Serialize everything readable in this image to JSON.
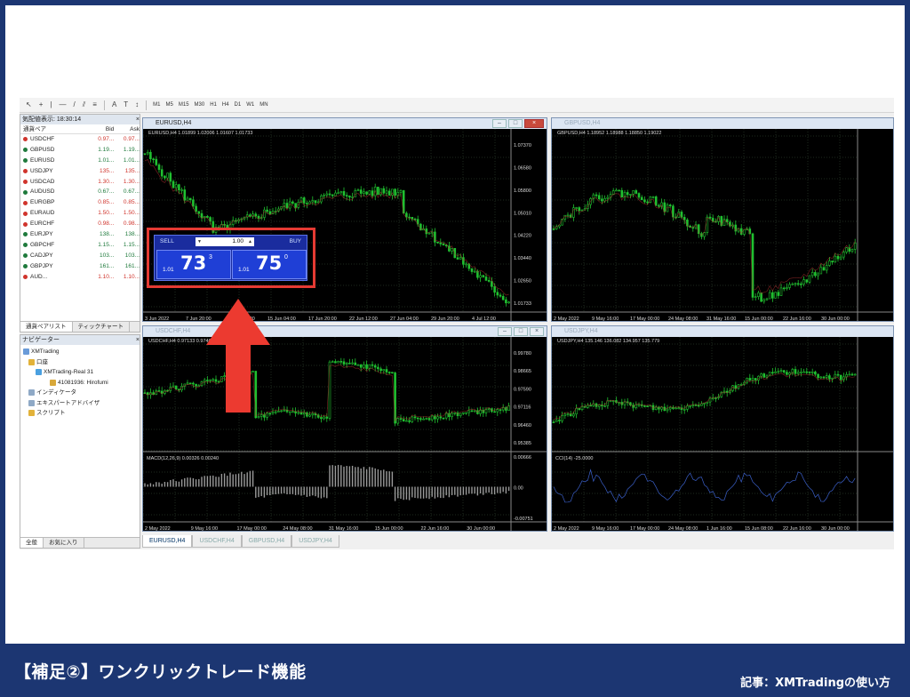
{
  "caption": "【補足②】ワンクリックトレード機能",
  "source": "記事：XMTradingの使い方",
  "toolbar": {
    "timeframes": [
      "M1",
      "M5",
      "M15",
      "M30",
      "H1",
      "H4",
      "D1",
      "W1",
      "MN"
    ]
  },
  "market_watch": {
    "title": "気配値表示: 18:30:14",
    "columns": [
      "通貨ペア",
      "Bid",
      "Ask"
    ],
    "rows": [
      {
        "symbol": "USDCHF",
        "bid": "0.97...",
        "ask": "0.97...",
        "color": "#d0342c"
      },
      {
        "symbol": "GBPUSD",
        "bid": "1.19...",
        "ask": "1.19...",
        "color": "#1f7a3c"
      },
      {
        "symbol": "EURUSD",
        "bid": "1.01...",
        "ask": "1.01...",
        "color": "#1f7a3c"
      },
      {
        "symbol": "USDJPY",
        "bid": "135...",
        "ask": "135...",
        "color": "#d0342c"
      },
      {
        "symbol": "USDCAD",
        "bid": "1.30...",
        "ask": "1.30...",
        "color": "#d0342c"
      },
      {
        "symbol": "AUDUSD",
        "bid": "0.67...",
        "ask": "0.67...",
        "color": "#1f7a3c"
      },
      {
        "symbol": "EURGBP",
        "bid": "0.85...",
        "ask": "0.85...",
        "color": "#d0342c"
      },
      {
        "symbol": "EURAUD",
        "bid": "1.50...",
        "ask": "1.50...",
        "color": "#d0342c"
      },
      {
        "symbol": "EURCHF",
        "bid": "0.98...",
        "ask": "0.98...",
        "color": "#d0342c"
      },
      {
        "symbol": "EURJPY",
        "bid": "138...",
        "ask": "138...",
        "color": "#1f7a3c"
      },
      {
        "symbol": "GBPCHF",
        "bid": "1.15...",
        "ask": "1.15...",
        "color": "#1f7a3c"
      },
      {
        "symbol": "CADJPY",
        "bid": "103...",
        "ask": "103...",
        "color": "#1f7a3c"
      },
      {
        "symbol": "GBPJPY",
        "bid": "161...",
        "ask": "161...",
        "color": "#1f7a3c"
      },
      {
        "symbol": "AUD...",
        "bid": "1.10...",
        "ask": "1.10...",
        "color": "#d0342c"
      }
    ],
    "tabs": [
      "通貨ペアリスト",
      "ティックチャート"
    ]
  },
  "navigator": {
    "title": "ナビゲーター",
    "items": [
      {
        "label": "XMTrading",
        "icon": "folder-icon"
      },
      {
        "label": "口座",
        "icon": "account-icon"
      },
      {
        "label": "XMTrading-Real 31",
        "icon": "server-icon"
      },
      {
        "label": "41081936: Hirofumi",
        "icon": "user-icon"
      },
      {
        "label": "インディケータ",
        "icon": "indicator-icon"
      },
      {
        "label": "エキスパートアドバイザ",
        "icon": "expert-icon"
      },
      {
        "label": "スクリプト",
        "icon": "script-icon"
      }
    ],
    "tabs": [
      "全般",
      "お気に入り"
    ]
  },
  "charts": [
    {
      "title": "EURUSD,H4",
      "info": "EURUSD,H4  1.01899 1.02006 1.01607 1.01733",
      "prices": [
        "1.07370",
        "1.06580",
        "1.05800",
        "1.05010",
        "1.04220",
        "1.03440",
        "1.02650",
        "1.01733"
      ],
      "dates": [
        "3 Jun 2022",
        "7 Jun 20:00",
        "10 Jun 12:00",
        "15 Jun 04:00",
        "17 Jun 20:00",
        "22 Jun 12:00",
        "27 Jun 04:00",
        "29 Jun 20:00",
        "4 Jul 12:00"
      ]
    },
    {
      "title": "GBPUSD,H4",
      "info": "GBPUSD,H4  1.18952 1.18988 1.18850 1.19022",
      "dates": [
        "2 May 2022",
        "9 May 16:00",
        "17 May 00:00",
        "24 May 08:00",
        "31 May 16:00",
        "15 Jun 00:00",
        "22 Jun 16:00",
        "30 Jun 00:00"
      ]
    },
    {
      "title": "USDCHF,H4",
      "info": "USDCHF,H4  0.97133 0.97400 0.96872 0.97116",
      "prices": [
        "0.99780",
        "0.98665",
        "0.97590",
        "0.97116",
        "0.96460",
        "0.95385"
      ],
      "indicator": "MACD(12,26,9) 0.00326 0.00240",
      "ind_prices": [
        "0.00666",
        "0.00",
        "-0.00751"
      ],
      "dates": [
        "2 May 2022",
        "9 May 16:00",
        "17 May 00:00",
        "24 May 08:00",
        "31 May 16:00",
        "15 Jun 00:00",
        "22 Jun 16:00",
        "30 Jun 00:00"
      ]
    },
    {
      "title": "USDJPY,H4",
      "info": "USDJPY,H4  135.146 136.082 134.957 135.779",
      "indicator": "CCI(14) -25.0000",
      "dates": [
        "2 May 2022",
        "9 May 16:00",
        "17 May 00:00",
        "24 May 08:00",
        "1 Jun 16:00",
        "15 Jun 08:00",
        "22 Jun 16:00",
        "30 Jun 00:00"
      ]
    }
  ],
  "trade_panel": {
    "sell": "SELL",
    "buy": "BUY",
    "lot": "1.00",
    "sell_pre": "1.01",
    "sell_big": "73",
    "sell_sup": "3",
    "buy_pre": "1.01",
    "buy_big": "75",
    "buy_sup": "0"
  },
  "bottom_tabs": [
    "EURUSD,H4",
    "USDCHF,H4",
    "GBPUSD,H4",
    "USDJPY,H4"
  ],
  "colors": {
    "frame": "#1c3672",
    "highlight": "#e53a33",
    "candle": "#20c030"
  }
}
